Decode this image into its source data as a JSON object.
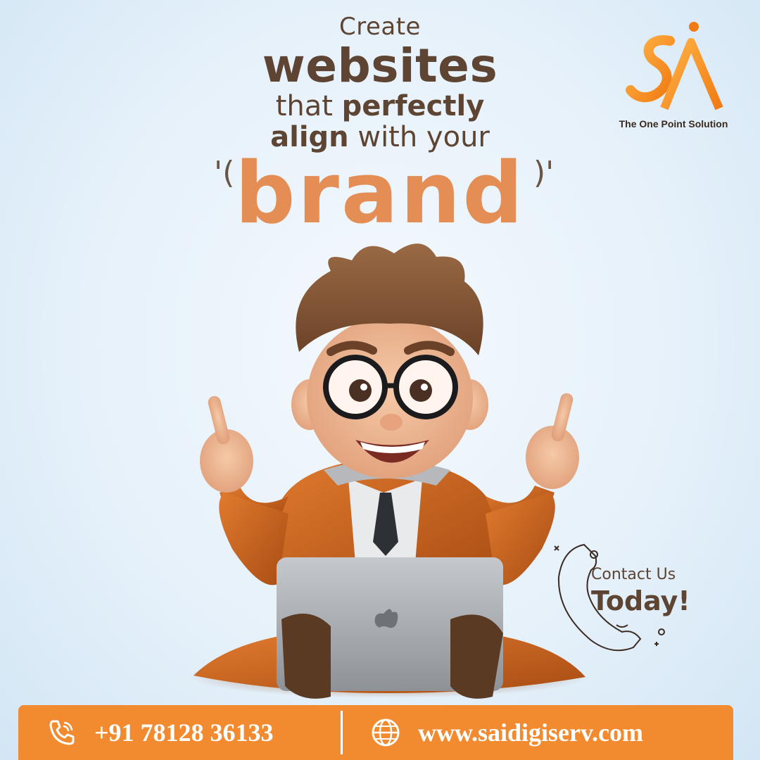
{
  "headline": {
    "line1": "Create",
    "line2": "websites",
    "line3_a": "that ",
    "line3_b": "perfectly",
    "line4_a": "align",
    "line4_b": " with your",
    "brand_word": "brand"
  },
  "logo": {
    "tagline": "The One Point Solution"
  },
  "contact": {
    "small": "Contact Us",
    "big": "Today!"
  },
  "footer": {
    "phone": "+91 78128 36133",
    "website": "www.saidigiserv.com"
  },
  "colors": {
    "accent": "#f28a2f",
    "brand_text": "#e48e56",
    "headline_text": "#5e4533"
  },
  "icons": {
    "phone": "phone-icon",
    "globe": "globe-icon"
  }
}
